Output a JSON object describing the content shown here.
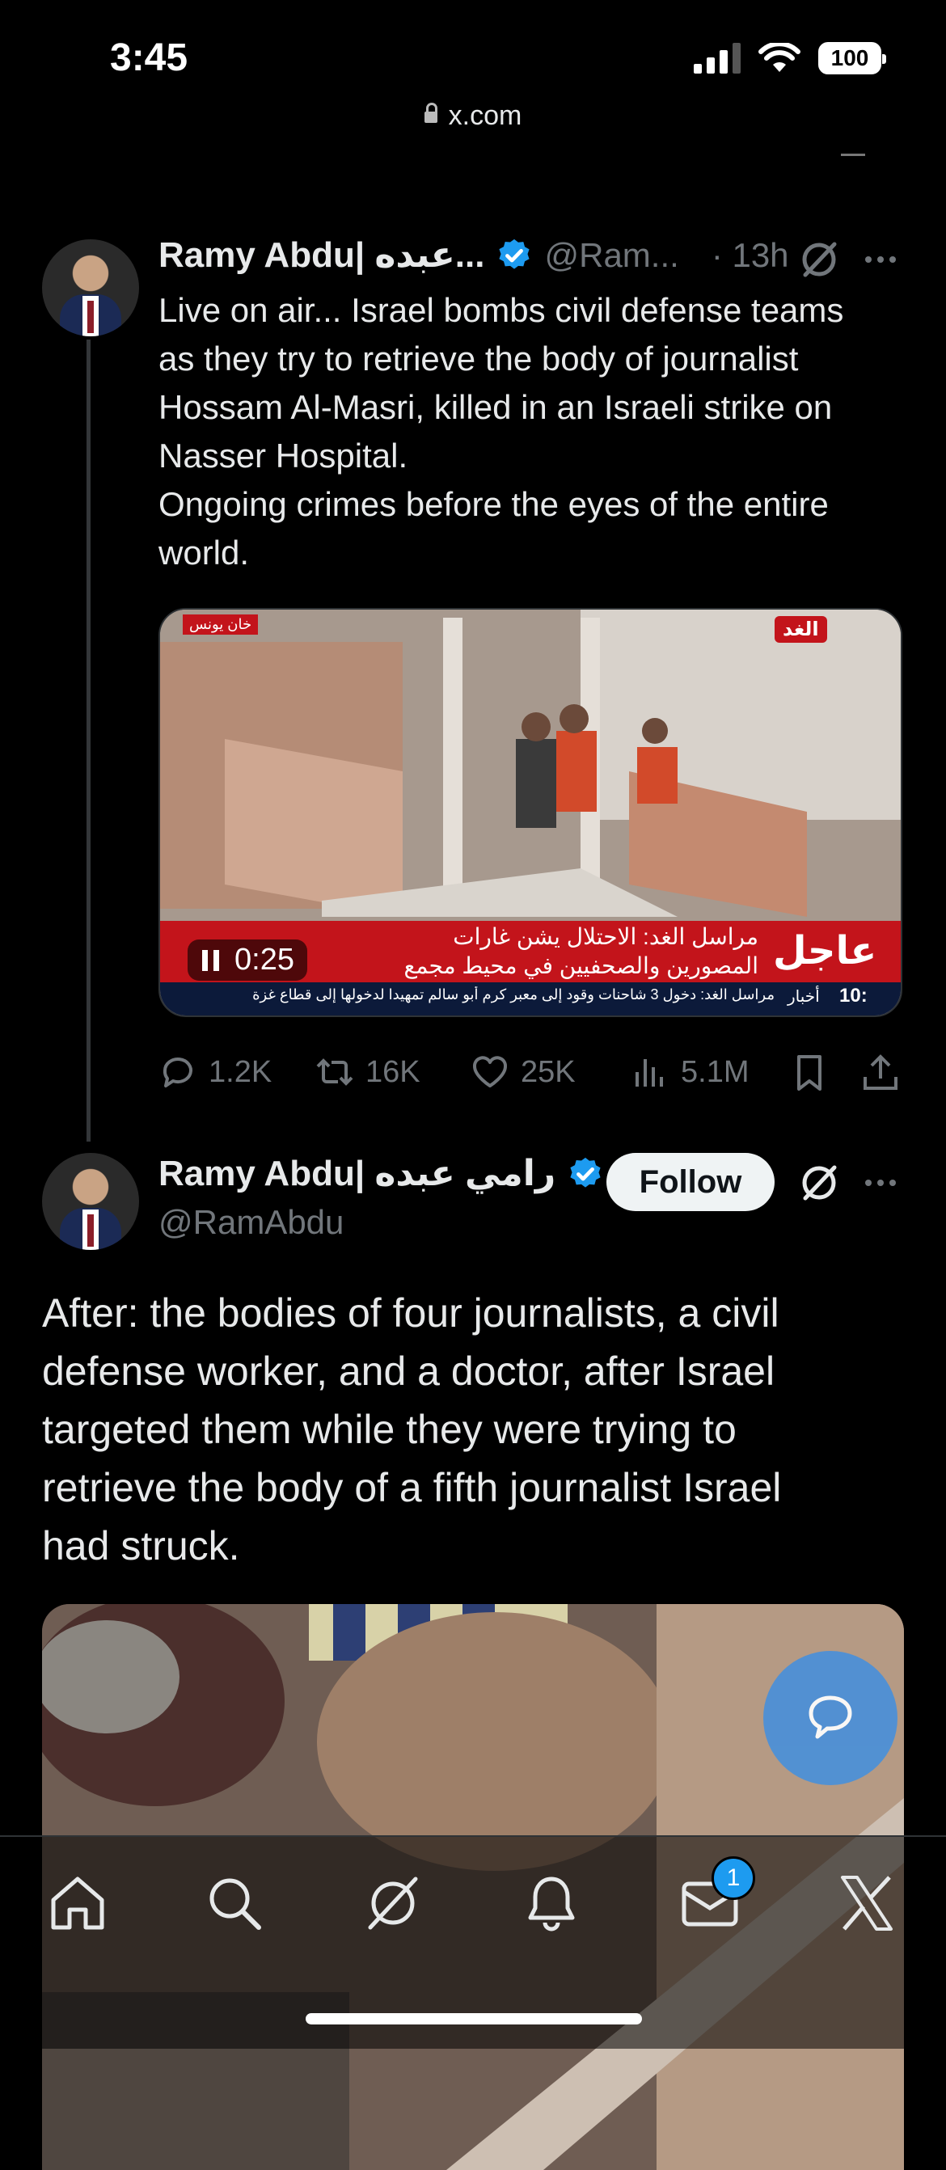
{
  "status_bar": {
    "time": "3:45",
    "battery": "100"
  },
  "browser": {
    "url": "x.com"
  },
  "tweet1": {
    "author_name": "Ramy Abdu| عبده...",
    "handle": "@Ram...",
    "time": "· 13h",
    "lines": [
      "Live on air... Israel bombs civil defense teams",
      "as they try to retrieve the body of journalist",
      "Hossam Al-Masri, killed in an Israeli strike on",
      "Nasser Hospital.",
      "Ongoing crimes before the eyes of the entire",
      "world."
    ],
    "video": {
      "duration": "0:25",
      "channel_logo": "الغد",
      "location_tag": "خان يونس",
      "breaking_label": "عاجل",
      "headline1": "مراسل الغد: الاحتلال يشن غارات",
      "headline2": "المصورين والصحفيين في محيط مجمع",
      "ticker": "مراسل الغد: دخول 3 شاحنات وقود إلى معبر كرم أبو سالم تمهيدا لدخولها إلى قطاع غزة",
      "ticker_label": "أخبار",
      "ticker_clock": "10:"
    },
    "stats": {
      "replies": "1.2K",
      "reposts": "16K",
      "likes": "25K",
      "views": "5.1M"
    }
  },
  "tweet2": {
    "author_name": "Ramy Abdu| رامي عبده",
    "handle": "@RamAbdu",
    "follow_label": "Follow",
    "lines": [
      "After: the bodies of four journalists, a civil",
      "defense worker, and a doctor, after Israel",
      "targeted them while they were trying to",
      "retrieve the body of a fifth journalist Israel",
      "had struck."
    ]
  },
  "nav": {
    "messages_badge": "1"
  },
  "colors": {
    "accent": "#1d9bf0",
    "background": "#000000",
    "text": "#e7e9ea",
    "muted": "#71767b"
  }
}
